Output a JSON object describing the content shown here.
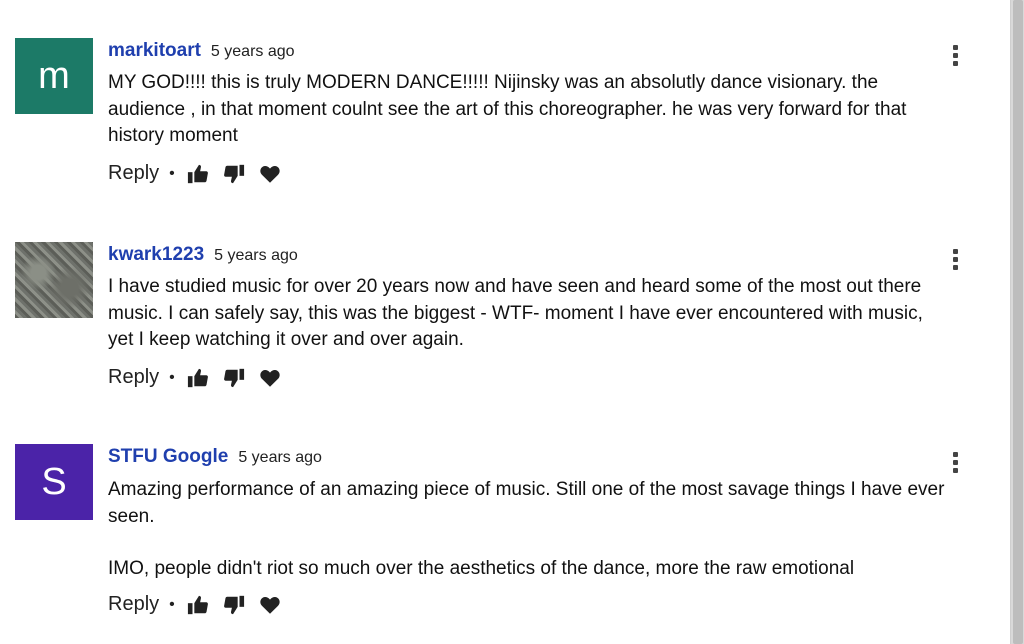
{
  "comments": [
    {
      "author": "markitoart",
      "time": "5 years ago",
      "avatar_letter": "m",
      "avatar_color": "#1c7a67",
      "paragraphs": [
        "MY GOD!!!! this is truly MODERN DANCE!!!!! Nijinsky was an absolutly dance visionary. the audience , in that moment coulnt see the art of this choreographer. he was very forward for that history moment"
      ],
      "reply_label": "Reply",
      "separator": "•"
    },
    {
      "author": "kwark1223",
      "time": "5 years ago",
      "paragraphs": [
        "I have studied music for over 20 years now and have seen and heard some of the most out there music. I can safely say, this was the biggest - WTF- moment I have ever encountered with music, yet I keep watching it over and over again."
      ],
      "reply_label": "Reply",
      "separator": "•"
    },
    {
      "author": "STFU Google",
      "time": "5 years ago",
      "avatar_letter": "S",
      "avatar_color": "#4b23a8",
      "paragraphs": [
        "Amazing performance of an amazing piece of music.  Still one of the most savage things I have ever seen.",
        "IMO, people didn't riot so much over the aesthetics of the dance, more the raw emotional"
      ],
      "reply_label": "Reply",
      "separator": "•"
    }
  ],
  "icons": {
    "like": "thumbs-up-icon",
    "dislike": "thumbs-down-icon",
    "heart": "heart-icon",
    "more": "more-vert-icon"
  }
}
